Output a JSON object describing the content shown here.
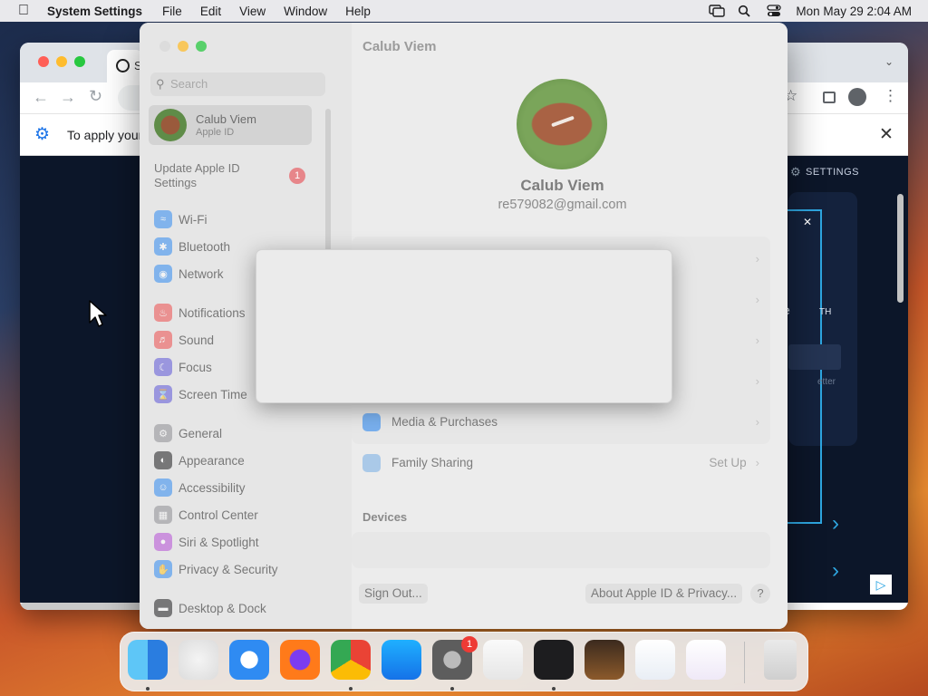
{
  "menubar": {
    "app_name": "System Settings",
    "menus": [
      "File",
      "Edit",
      "View",
      "Window",
      "Help"
    ],
    "clock": "Mon May 29  2:04 AM"
  },
  "chrome": {
    "tab_title_partial": "S",
    "infobar_text": "To apply your",
    "page_settings_label": "SETTINGS",
    "page_fragment_1": "e",
    "page_fragment_2": "TH",
    "page_fragment_3": "etter"
  },
  "settings": {
    "window_title": "Calub Viem",
    "search_placeholder": "Search",
    "profile": {
      "name": "Calub Viem",
      "subtitle": "Apple ID"
    },
    "update": {
      "label": "Update Apple ID Settings",
      "badge": "1"
    },
    "sidebar_groups": [
      [
        {
          "label": "Wi-Fi",
          "icon": "wifi-icon",
          "color": "#2f8bf2"
        },
        {
          "label": "Bluetooth",
          "icon": "bluetooth-icon",
          "color": "#2f8bf2"
        },
        {
          "label": "Network",
          "icon": "globe-icon",
          "color": "#2f8bf2"
        }
      ],
      [
        {
          "label": "Notifications",
          "icon": "bell-icon",
          "color": "#ef4d4d"
        },
        {
          "label": "Sound",
          "icon": "speaker-icon",
          "color": "#ef4d4d"
        },
        {
          "label": "Focus",
          "icon": "moon-icon",
          "color": "#5d55d8"
        },
        {
          "label": "Screen Time",
          "icon": "hourglass-icon",
          "color": "#5d55d8"
        }
      ],
      [
        {
          "label": "General",
          "icon": "gear-icon",
          "color": "#8e8e93"
        },
        {
          "label": "Appearance",
          "icon": "appearance-icon",
          "color": "#1d1d1f"
        },
        {
          "label": "Accessibility",
          "icon": "accessibility-icon",
          "color": "#2f8bf2"
        },
        {
          "label": "Control Center",
          "icon": "control-center-icon",
          "color": "#8e8e93"
        },
        {
          "label": "Siri & Spotlight",
          "icon": "siri-icon",
          "color": "#b54fd6"
        },
        {
          "label": "Privacy & Security",
          "icon": "hand-icon",
          "color": "#2f8bf2"
        }
      ],
      [
        {
          "label": "Desktop & Dock",
          "icon": "dock-icon",
          "color": "#1d1d1f"
        }
      ]
    ],
    "main": {
      "user_name": "Calub Viem",
      "email": "re579082@gmail.com",
      "rows": [
        {
          "label": "",
          "extra": ""
        },
        {
          "label": "",
          "extra": ""
        },
        {
          "label": "",
          "extra": ""
        },
        {
          "label": "",
          "extra": ""
        },
        {
          "label": "Media & Purchases",
          "extra": "",
          "icon": "app-store-icon",
          "color": "#2f8bf2"
        },
        {
          "label": "Family Sharing",
          "extra": "Set Up",
          "icon": "family-icon",
          "color": "#7fb3e6"
        }
      ],
      "devices_heading": "Devices",
      "sign_out": "Sign Out...",
      "about": "About Apple ID & Privacy...",
      "help": "?"
    }
  },
  "dock": {
    "apps": [
      {
        "name": "finder",
        "running": true
      },
      {
        "name": "launchpad",
        "running": false
      },
      {
        "name": "safari",
        "running": false
      },
      {
        "name": "firefox",
        "running": false
      },
      {
        "name": "chrome",
        "running": true
      },
      {
        "name": "app-store",
        "running": false
      },
      {
        "name": "system-settings",
        "running": true,
        "badge": "1"
      },
      {
        "name": "textedit",
        "running": false
      },
      {
        "name": "terminal",
        "running": true
      },
      {
        "name": "garageband",
        "running": false
      },
      {
        "name": "vscode",
        "running": false
      },
      {
        "name": "visual-studio",
        "running": false
      },
      {
        "name": "trash",
        "running": false
      }
    ]
  }
}
